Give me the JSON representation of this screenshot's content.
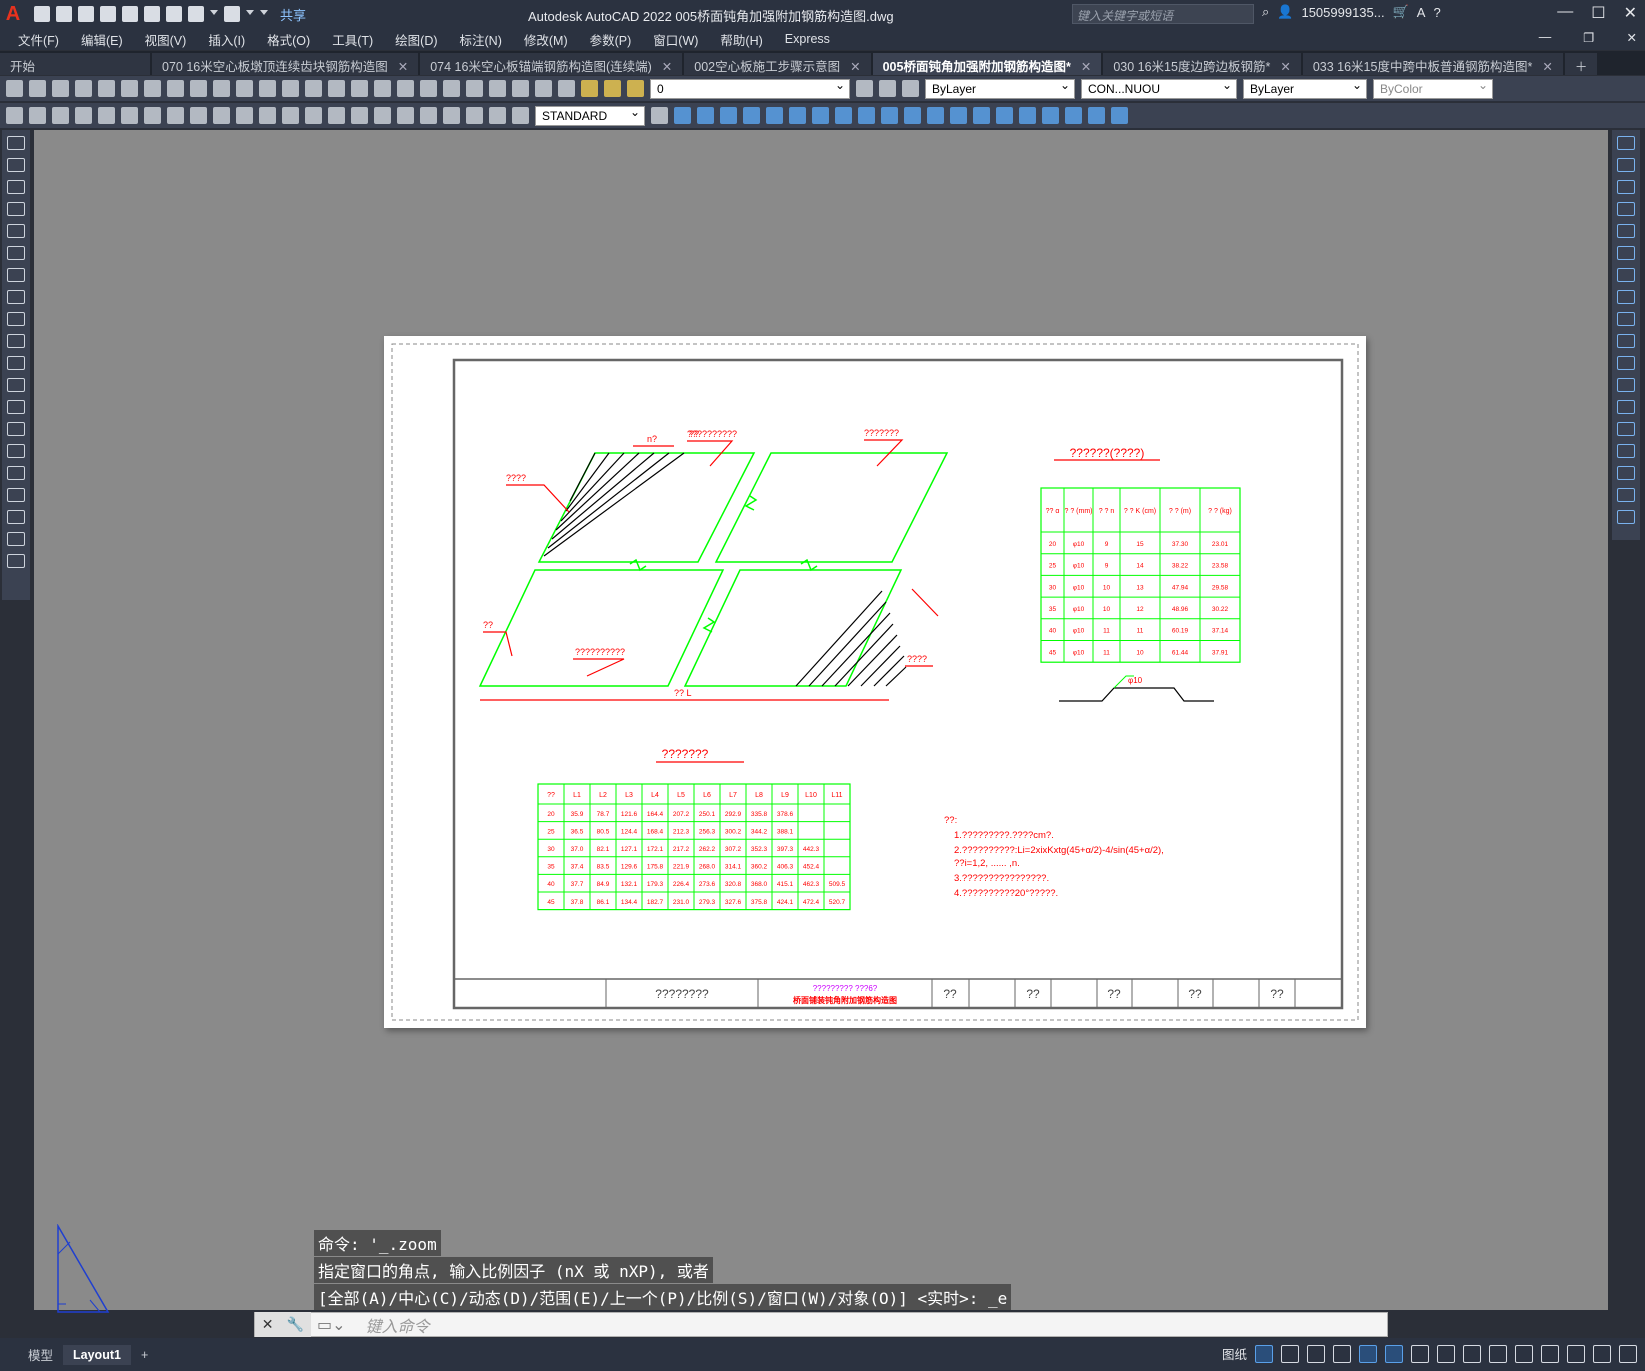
{
  "app": {
    "logo": "A",
    "title": "Autodesk AutoCAD 2022    005桥面钝角加强附加钢筋构造图.dwg",
    "share": "共享",
    "search_placeholder": "键入关键字或短语",
    "user": "1505999135...",
    "help": "?"
  },
  "menu": [
    "文件(F)",
    "编辑(E)",
    "视图(V)",
    "插入(I)",
    "格式(O)",
    "工具(T)",
    "绘图(D)",
    "标注(N)",
    "修改(M)",
    "参数(P)",
    "窗口(W)",
    "帮助(H)",
    "Express"
  ],
  "tabs": [
    {
      "label": "开始",
      "close": ""
    },
    {
      "label": "070 16米空心板墩顶连续齿块钢筋构造图",
      "close": "✕"
    },
    {
      "label": "074  16米空心板锚端钢筋构造图(连续端)",
      "close": "✕"
    },
    {
      "label": "002空心板施工步骤示意图",
      "close": "✕"
    },
    {
      "label": "005桥面钝角加强附加钢筋构造图*",
      "close": "✕",
      "active": true
    },
    {
      "label": "030 16米15度边跨边板钢筋*",
      "close": "✕"
    },
    {
      "label": "033 16米15度中跨中板普通钢筋构造图*",
      "close": "✕"
    }
  ],
  "toolbar": {
    "layer": "0",
    "color": "ByLayer",
    "linetype": "CON...NUOU",
    "lineweight": "ByLayer",
    "plotstyle": "ByColor",
    "textstyle": "STANDARD"
  },
  "drawing": {
    "labels_q": [
      "????",
      "??????????",
      "??????",
      "???????",
      "??????????",
      "????",
      "??",
      "??   L",
      "n?"
    ],
    "table_title": "??????(????)",
    "table2_title": "???????",
    "rebar_label": "φ10",
    "table1": {
      "headers": [
        "?? α",
        "? ? (mm)",
        "? ? n",
        "? ? K (cm)",
        "? ? (m)",
        "? ? (kg)"
      ],
      "rows": [
        [
          "20",
          "φ10",
          "9",
          "15",
          "37.30",
          "23.01"
        ],
        [
          "25",
          "φ10",
          "9",
          "14",
          "38.22",
          "23.58"
        ],
        [
          "30",
          "φ10",
          "10",
          "13",
          "47.94",
          "29.58"
        ],
        [
          "35",
          "φ10",
          "10",
          "12",
          "48.96",
          "30.22"
        ],
        [
          "40",
          "φ10",
          "11",
          "11",
          "60.19",
          "37.14"
        ],
        [
          "45",
          "φ10",
          "11",
          "10",
          "61.44",
          "37.91"
        ]
      ]
    },
    "table2": {
      "headers": [
        "??",
        "L1",
        "L2",
        "L3",
        "L4",
        "L5",
        "L6",
        "L7",
        "L8",
        "L9",
        "L10",
        "L11"
      ],
      "rows": [
        [
          "20",
          "35.9",
          "78.7",
          "121.6",
          "164.4",
          "207.2",
          "250.1",
          "292.9",
          "335.8",
          "378.6",
          "",
          ""
        ],
        [
          "25",
          "36.5",
          "80.5",
          "124.4",
          "168.4",
          "212.3",
          "256.3",
          "300.2",
          "344.2",
          "388.1",
          "",
          ""
        ],
        [
          "30",
          "37.0",
          "82.1",
          "127.1",
          "172.1",
          "217.2",
          "262.2",
          "307.2",
          "352.3",
          "397.3",
          "442.3",
          ""
        ],
        [
          "35",
          "37.4",
          "83.5",
          "129.6",
          "175.8",
          "221.9",
          "268.0",
          "314.1",
          "360.2",
          "406.3",
          "452.4",
          ""
        ],
        [
          "40",
          "37.7",
          "84.9",
          "132.1",
          "179.3",
          "226.4",
          "273.6",
          "320.8",
          "368.0",
          "415.1",
          "462.3",
          "509.5"
        ],
        [
          "45",
          "37.8",
          "86.1",
          "134.4",
          "182.7",
          "231.0",
          "279.3",
          "327.6",
          "375.8",
          "424.1",
          "472.4",
          "520.7"
        ]
      ]
    },
    "notes_title": "??:",
    "notes": [
      "1.?????????.????cm?.",
      "2.??????????:Li=2xixKxtg(45+α/2)-4/sin(45+α/2),",
      "   ??i=1,2,   ......      ,n.",
      "3.????????????????.",
      "4.??????????20°?????."
    ],
    "titleblock": {
      "project": "????????",
      "drawing_q": "?????????  ???6?",
      "drawing_name": "桥面铺装钝角附加钢筋构造图",
      "cells": [
        "??",
        "??",
        "??",
        "??",
        "??"
      ]
    }
  },
  "command": {
    "history": [
      "命令: '_.zoom",
      "指定窗口的角点, 输入比例因子 (nX 或 nXP), 或者",
      "[全部(A)/中心(C)/动态(D)/范围(E)/上一个(P)/比例(S)/窗口(W)/对象(O)] <实时>: _e"
    ],
    "placeholder": "键入命令"
  },
  "status": {
    "model": "模型",
    "layout": "Layout1",
    "add": "+",
    "paper": "图纸"
  },
  "colors": {
    "accent": "#5aa0e8",
    "drawing_green": "#00ff00",
    "drawing_red": "#ff0000",
    "canvas": "#8a8a8a"
  }
}
